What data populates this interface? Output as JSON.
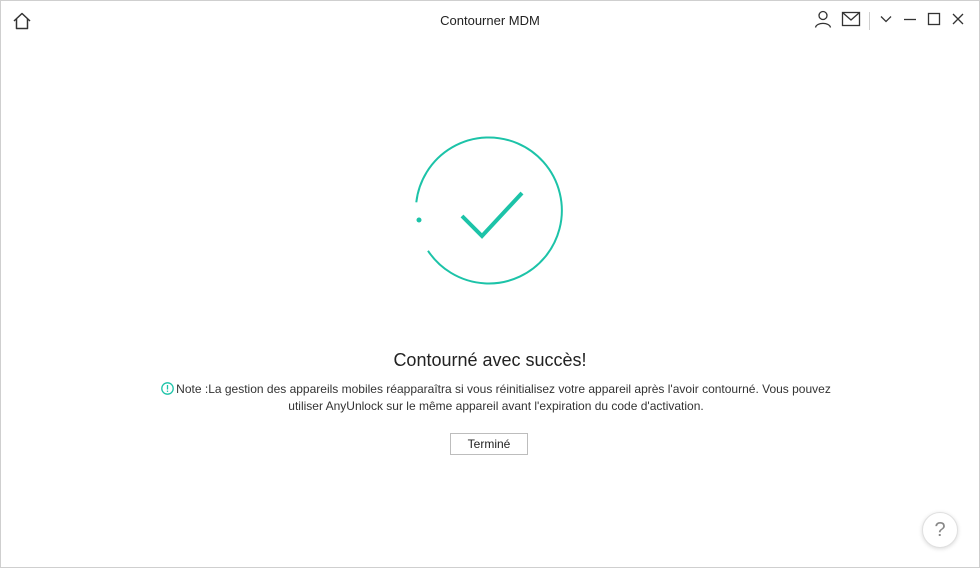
{
  "window": {
    "title": "Contourner MDM"
  },
  "titlebar_icons": [
    "home-icon",
    "user-icon",
    "mail-icon",
    "chevron-down-icon",
    "minimize-icon",
    "maximize-icon",
    "close-icon"
  ],
  "success": {
    "headline": "Contourné avec succès!",
    "note_prefix": "Note :",
    "note_text": "La gestion des appareils mobiles réapparaîtra si vous réinitialisez votre appareil après l'avoir contourné. Vous pouvez utiliser AnyUnlock sur le même appareil avant l'expiration du code d'activation.",
    "done_label": "Terminé"
  },
  "help": {
    "label": "?"
  },
  "colors": {
    "accent": "#1cc3a8",
    "text": "#222222",
    "border": "#bdbdbd"
  }
}
